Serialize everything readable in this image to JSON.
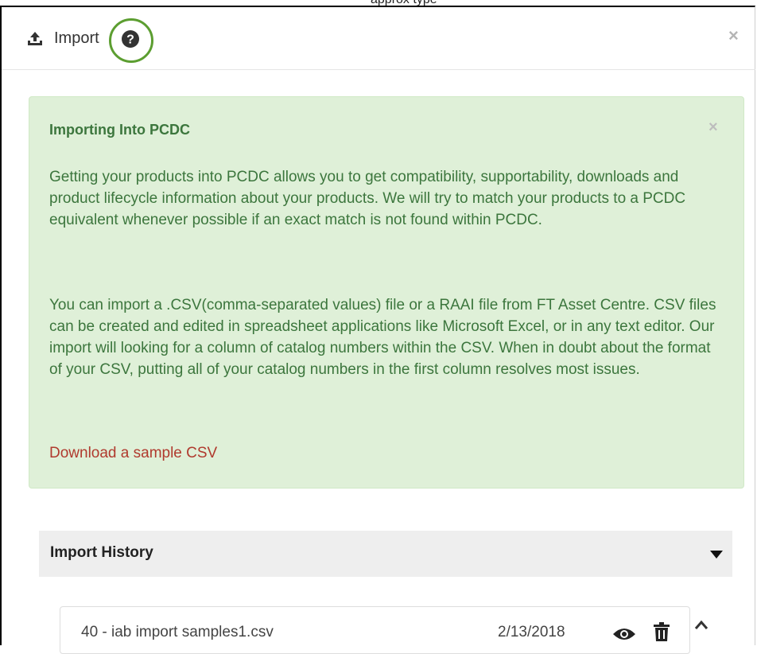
{
  "top_strip": {
    "text": "approx type"
  },
  "modal": {
    "title": "Import",
    "icons": {
      "upload": "upload-icon",
      "help": "question-circle-icon",
      "close": "close-icon"
    },
    "close_glyph": "×"
  },
  "alert": {
    "title": "Importing Into PCDC",
    "close_glyph": "×",
    "paragraph1": "Getting your products into PCDC allows you to get compatibility, supportability, downloads and product lifecycle information about your products. We will try to match your products to a PCDC equivalent whenever possible if an exact match is not found within PCDC.",
    "paragraph2": "You can import a .CSV(comma-separated values) file or a RAAI file from FT Asset Centre. CSV files can be created and edited in spreadsheet applications like Microsoft Excel, or in any text editor. Our import will looking for a column of catalog numbers within the CSV. When in doubt about the format of your CSV, putting all of your catalog numbers in the first column resolves most issues.",
    "link": "Download a sample CSV"
  },
  "history": {
    "title": "Import History",
    "items": [
      {
        "name": "40 - iab import samples1.csv",
        "date": "2/13/2018",
        "icons": [
          "eye-icon",
          "trash-icon"
        ]
      }
    ]
  },
  "colors": {
    "alert_bg": "#dff0d8",
    "alert_text": "#3c763d",
    "link": "#b03a2e",
    "highlight_ring": "#5c9e31",
    "history_header_bg": "#eeeeee"
  }
}
